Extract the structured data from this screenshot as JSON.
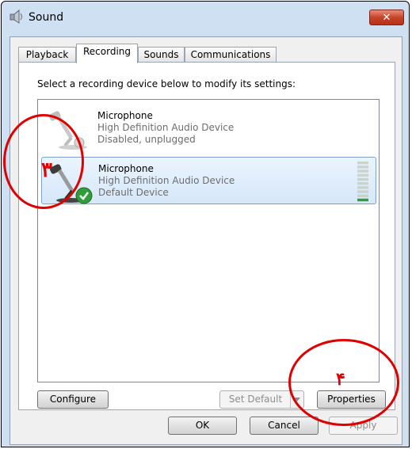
{
  "window": {
    "title": "Sound",
    "close_label": "✕"
  },
  "tabs": [
    {
      "label": "Playback"
    },
    {
      "label": "Recording"
    },
    {
      "label": "Sounds"
    },
    {
      "label": "Communications"
    }
  ],
  "instruction": "Select a recording device below to modify its settings:",
  "devices": [
    {
      "name": "Microphone",
      "description": "High Definition Audio Device",
      "status": "Disabled, unplugged",
      "selected": false
    },
    {
      "name": "Microphone",
      "description": "High Definition Audio Device",
      "status": "Default Device",
      "selected": true,
      "level": 0.12
    }
  ],
  "buttons": {
    "configure": "Configure",
    "set_default": "Set Default",
    "properties": "Properties",
    "ok": "OK",
    "cancel": "Cancel",
    "apply": "Apply"
  },
  "annotations": {
    "device_number": "۳",
    "properties_number": "۴",
    "color": "#e00000"
  }
}
